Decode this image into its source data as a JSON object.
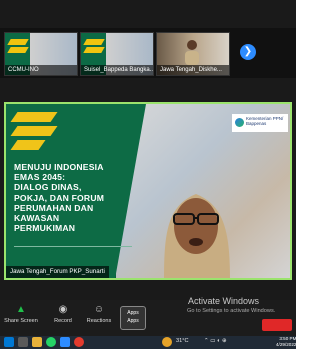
{
  "participants": [
    {
      "name": "CCMU-INO"
    },
    {
      "name": "Suisel_Bappeda Bangka..."
    },
    {
      "name": "Jawa Tengah_Diskhe..."
    }
  ],
  "main_slide": {
    "title_lines": [
      "MENUJU INDONESIA",
      "EMAS 2045:",
      "DIALOG DINAS,",
      "POKJA, DAN FORUM",
      "PERUMAHAN DAN",
      "KAWASAN",
      "PERMUKIMAN"
    ],
    "logo_text_1": "Kementerian PPN/",
    "logo_text_2": "Bappenas",
    "speaker_name": "Jawa Tengah_Forum PKP_Sunarti"
  },
  "toolbar": {
    "share_screen": "Share Screen",
    "record": "Record",
    "reactions": "Reactions",
    "apps": "Apps"
  },
  "overlay": {
    "activate_title": "Activate Windows",
    "activate_sub": "Go to Settings to activate Windows."
  },
  "taskbar": {
    "temperature": "31°C",
    "time": "3:50 PM",
    "date": "4/29/2022"
  },
  "colors": {
    "accent_green": "#0d6b45",
    "accent_yellow": "#f0c419",
    "speaker_border": "#9be36d",
    "zoom_blue": "#2d8cff"
  }
}
